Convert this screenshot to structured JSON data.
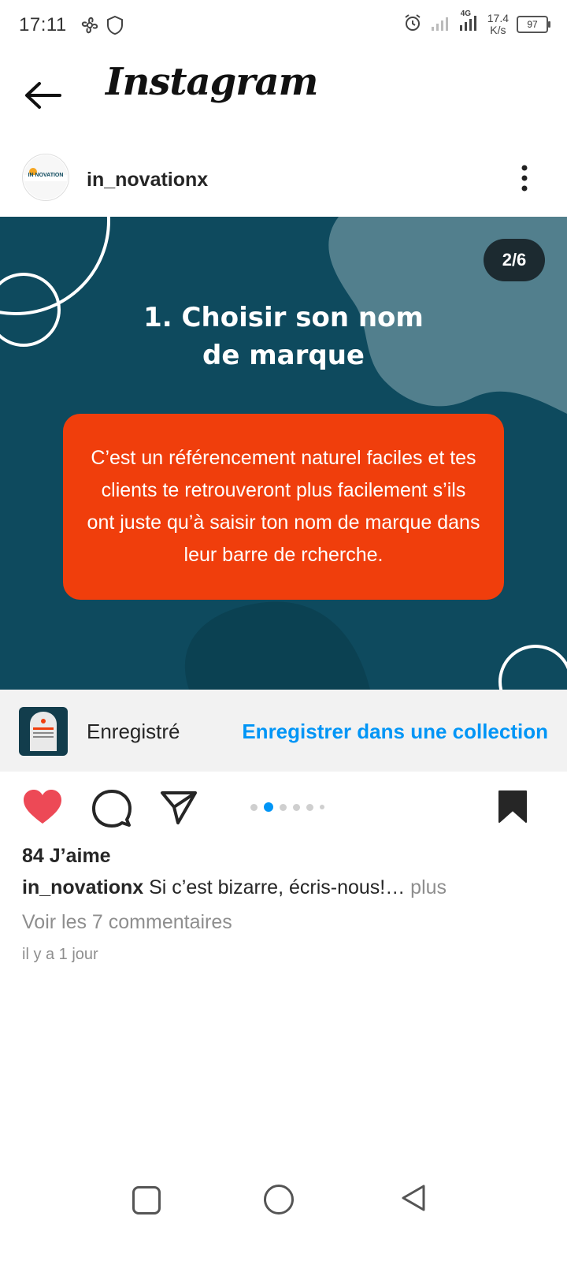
{
  "status_bar": {
    "time": "17:11",
    "network": "4G",
    "speed_value": "17.4",
    "speed_unit": "K/s",
    "battery": "97"
  },
  "header": {
    "app_title": "Instagram"
  },
  "post": {
    "username": "in_novationx",
    "avatar_text": "IN NOVATION",
    "slide_counter": "2/6",
    "slide_title_line1": "1. Choisir son nom",
    "slide_title_line2": "de marque",
    "slide_body": "C’est un référencement naturel faciles et tes clients te retrouveront plus facilement s’ils ont juste qu’à saisir ton nom de marque dans leur barre de rcherche.",
    "saved_label": "Enregistré",
    "save_collection_label": "Enregistrer dans une collection",
    "likes": "84 J’aime",
    "caption_user": "in_novationx",
    "caption_text": " Si c’est bizarre, écris-nous!…",
    "caption_more": " plus",
    "view_comments": "Voir les 7 commentaires",
    "time_ago": "il y a 1 jour",
    "carousel_index": 2,
    "carousel_total": 6
  },
  "colors": {
    "like_red": "#ed4956",
    "link_blue": "#0095f6",
    "slide_bg": "#0e4a5e",
    "slide_box": "#f03e0c"
  }
}
